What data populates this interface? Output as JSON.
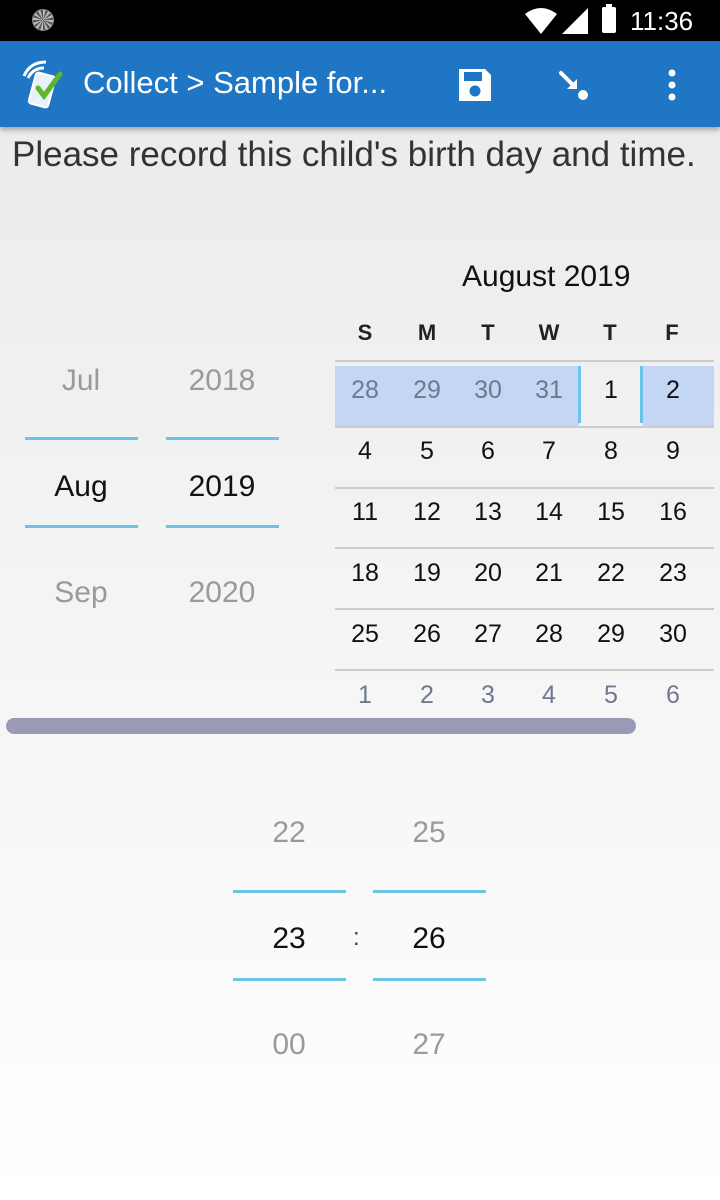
{
  "status_bar": {
    "time": "11:36"
  },
  "app_bar": {
    "title": "Collect > Sample for..."
  },
  "question": "Please record this child's birth day and time.",
  "date_picker": {
    "months": [
      "Jul",
      "Aug",
      "Sep"
    ],
    "years": [
      "2018",
      "2019",
      "2020"
    ],
    "selected_month": "Aug",
    "selected_year": "2019"
  },
  "calendar": {
    "month_label": "August 2019",
    "weekdays": [
      "S",
      "M",
      "T",
      "W",
      "T",
      "F"
    ],
    "weeks": [
      [
        "28",
        "29",
        "30",
        "31",
        "1",
        "2"
      ],
      [
        "4",
        "5",
        "6",
        "7",
        "8",
        "9"
      ],
      [
        "11",
        "12",
        "13",
        "14",
        "15",
        "16"
      ],
      [
        "18",
        "19",
        "20",
        "21",
        "22",
        "23"
      ],
      [
        "25",
        "26",
        "27",
        "28",
        "29",
        "30"
      ],
      [
        "1",
        "2",
        "3",
        "4",
        "5",
        "6"
      ]
    ]
  },
  "time_picker": {
    "hours": [
      "22",
      "23",
      "00"
    ],
    "minutes": [
      "25",
      "26",
      "27"
    ],
    "separator": ":",
    "selected_hour": "23",
    "selected_minute": "26"
  }
}
